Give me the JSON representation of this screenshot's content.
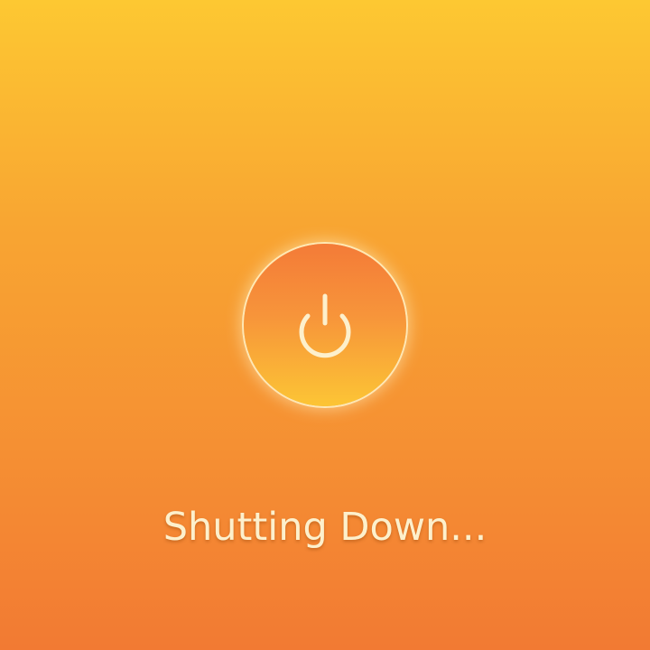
{
  "shutdown_screen": {
    "status_text": "Shutting Down...",
    "icon": "power-icon",
    "colors": {
      "background_top": "#fdc832",
      "background_bottom": "#f27a33",
      "circle_top": "#f47b38",
      "circle_bottom": "#fcc535",
      "foreground": "#fdf0cc"
    }
  }
}
